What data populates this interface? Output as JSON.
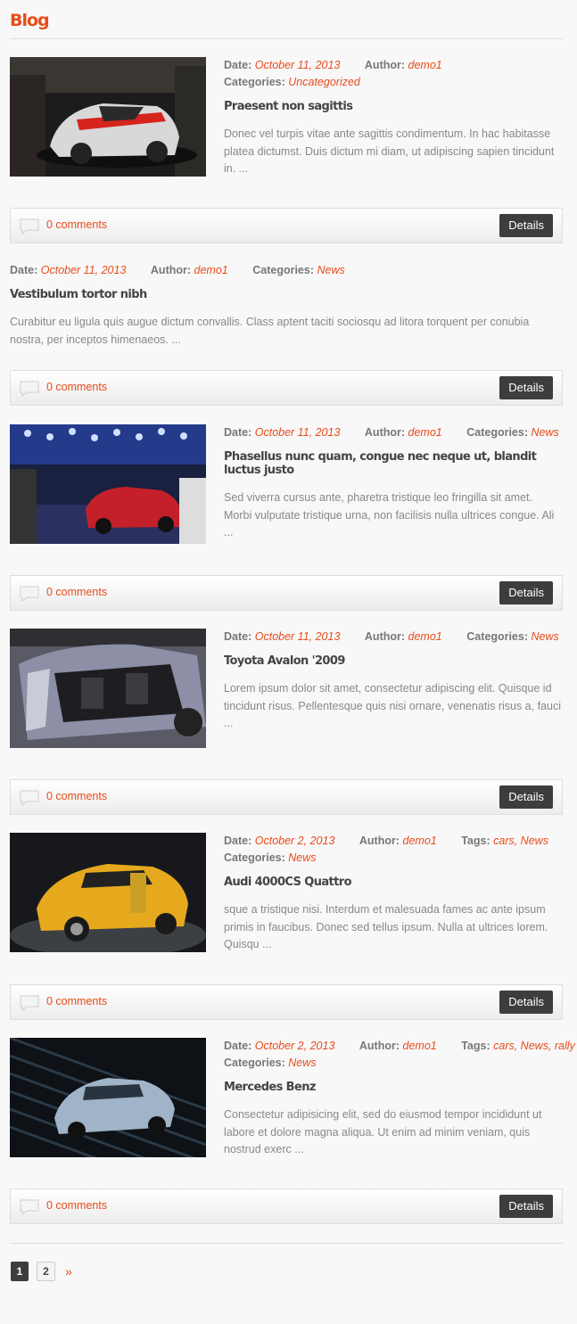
{
  "page": {
    "title": "Blog"
  },
  "labels": {
    "date": "Date:",
    "author": "Author:",
    "categories": "Categories:",
    "tags": "Tags:",
    "details": "Details"
  },
  "posts": [
    {
      "date": "October 11, 2013",
      "author": "demo1",
      "categories": "Uncategorized",
      "title": "Praesent non sagittis",
      "excerpt": "Donec vel turpis vitae ante sagittis condimentum. In hac habitasse platea dictumst. Duis dictum mi diam, ut adipiscing sapien tincidunt in. ...",
      "comments": "0 comments"
    },
    {
      "date": "October 11, 2013",
      "author": "demo1",
      "categories": "News",
      "title": "Vestibulum tortor nibh",
      "excerpt": "Curabitur eu ligula quis augue dictum convallis. Class aptent taciti sociosqu ad litora torquent per conubia nostra, per inceptos himenaeos. ...",
      "comments": "0 comments"
    },
    {
      "date": "October 11, 2013",
      "author": "demo1",
      "categories": "News",
      "title": "Phasellus nunc quam, congue nec neque ut, blandit luctus justo",
      "excerpt": "Sed viverra cursus ante, pharetra tristique leo fringilla sit amet. Morbi vulputate tristique urna, non facilisis nulla ultrices congue. Ali ...",
      "comments": "0 comments"
    },
    {
      "date": "October 11, 2013",
      "author": "demo1",
      "categories": "News",
      "title": "Toyota Avalon '2009",
      "excerpt": "Lorem ipsum dolor sit amet, consectetur adipiscing elit. Quisque id tincidunt risus. Pellentesque quis nisi ornare, venenatis risus a, fauci ...",
      "comments": "0 comments"
    },
    {
      "date": "October 2, 2013",
      "author": "demo1",
      "tags": "cars, News",
      "categories": "News",
      "title": "Audi 4000CS Quattro",
      "excerpt": "sque a tristique nisi. Interdum et malesuada fames ac ante ipsum primis in faucibus. Donec sed tellus ipsum. Nulla at ultrices lorem. Quisqu ...",
      "comments": "0 comments"
    },
    {
      "date": "October 2, 2013",
      "author": "demo1",
      "tags": "cars, News, rally",
      "categories": "News",
      "title": "Mercedes Benz",
      "excerpt": "Consectetur adipisicing elit, sed do eiusmod tempor incididunt ut labore et dolore magna aliqua. Ut enim ad minim veniam, quis nostrud exerc ...",
      "comments": "0 comments"
    }
  ],
  "pagination": {
    "pages": [
      "1",
      "2"
    ],
    "current": "1",
    "next": "»"
  },
  "colors": {
    "accent": "#e84c1b",
    "button": "#3d3d3d",
    "background": "#f8f8f8"
  },
  "icons": {
    "comment": "comment-icon"
  }
}
